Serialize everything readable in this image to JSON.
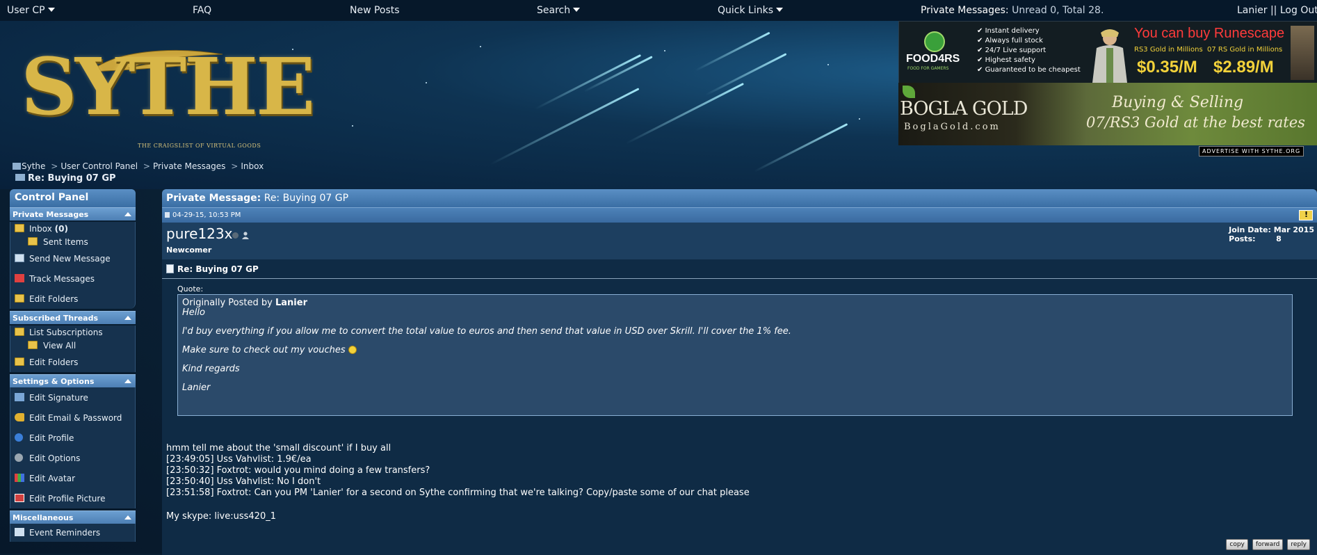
{
  "topnav": {
    "user_cp": "User CP",
    "faq": "FAQ",
    "new_posts": "New Posts",
    "search": "Search",
    "quick_links": "Quick Links",
    "pm_label": "Private Messages:",
    "pm_counts": "Unread 0, Total 28.",
    "user": "Lanier",
    "separator": "||",
    "logout": "Log Out"
  },
  "logo": {
    "text": "SYTHE",
    "tagline": "THE CRAIGSLIST OF VIRTUAL GOODS"
  },
  "ads": {
    "food4rs": {
      "brand": "FOOD4RS",
      "brand_sub": "FOOD FOR GAMERS",
      "features": [
        "Instant delivery",
        "Always full stock",
        "24/7 Live support",
        "Highest safety",
        "Guaranteed to be cheapest"
      ],
      "headline": "You can buy Runescape",
      "rs3_label": "RS3 Gold in Millions",
      "osrs_label": "07 RS Gold in Millions",
      "rs3_price": "$0.35/M",
      "osrs_price": "$2.89/M"
    },
    "bogla": {
      "brand": "BOGLA GOLD",
      "domain": "BoglaGold.com",
      "slogan_1": "Buying & Selling",
      "slogan_2": "07/RS3 Gold at the best rates"
    },
    "advertise": "ADVERTISE WITH SYTHE.ORG"
  },
  "breadcrumb": {
    "items": [
      "Sythe",
      "User Control Panel",
      "Private Messages",
      "Inbox"
    ],
    "separator": ">",
    "current": "Re: Buying 07 GP"
  },
  "sidebar": {
    "title": "Control Panel",
    "sections": {
      "pm": {
        "title": "Private Messages",
        "inbox": "Inbox",
        "inbox_count": "(0)",
        "sent": "Sent Items",
        "send_new": "Send New Message",
        "track": "Track Messages",
        "edit_folders": "Edit Folders"
      },
      "subscribed": {
        "title": "Subscribed Threads",
        "list": "List Subscriptions",
        "view_all": "View All",
        "edit_folders": "Edit Folders"
      },
      "settings": {
        "title": "Settings & Options",
        "signature": "Edit Signature",
        "email_password": "Edit Email & Password",
        "profile": "Edit Profile",
        "options": "Edit Options",
        "avatar": "Edit Avatar",
        "profile_picture": "Edit Profile Picture"
      },
      "misc": {
        "title": "Miscellaneous",
        "event_reminders": "Event Reminders"
      }
    }
  },
  "message": {
    "header_label": "Private Message:",
    "header_title": "Re: Buying 07 GP",
    "date": "04-29-15, 10:53 PM",
    "username": "pure123x",
    "user_title": "Newcomer",
    "join_label": "Join Date:",
    "join_value": "Mar 2015",
    "posts_label": "Posts:",
    "posts_value": "8",
    "title": "Re: Buying 07 GP",
    "quote_label": "Quote:",
    "quote_prefix": "Originally Posted by",
    "quote_author": "Lanier",
    "quote_lines": [
      "Hello",
      "",
      "I'd buy everything if you allow me to convert the total value to euros and then send that value in USD over Skrill. I'll cover the 1% fee.",
      "",
      "Make sure to check out my vouches",
      "",
      "Kind regards",
      "",
      "Lanier"
    ],
    "body_lines": [
      "hmm tell me about the 'small discount' if I buy all",
      "[23:49:05] Uss Vahvlist: 1.9€/ea",
      "[23:50:32] Foxtrot: would you mind doing a few transfers?",
      "[23:50:40] Uss Vahvlist: No I don't",
      "[23:51:58] Foxtrot: Can you PM 'Lanier' for a second on Sythe confirming that we're talking? Copy/paste some of our chat please"
    ],
    "skype": "My skype: live:uss420_1",
    "actions": {
      "copy": "copy",
      "forward": "forward",
      "reply": "reply"
    }
  },
  "colors": {
    "accent": "#4d7fb4",
    "background": "#0b2236",
    "logo_gold": "#d8b648"
  }
}
